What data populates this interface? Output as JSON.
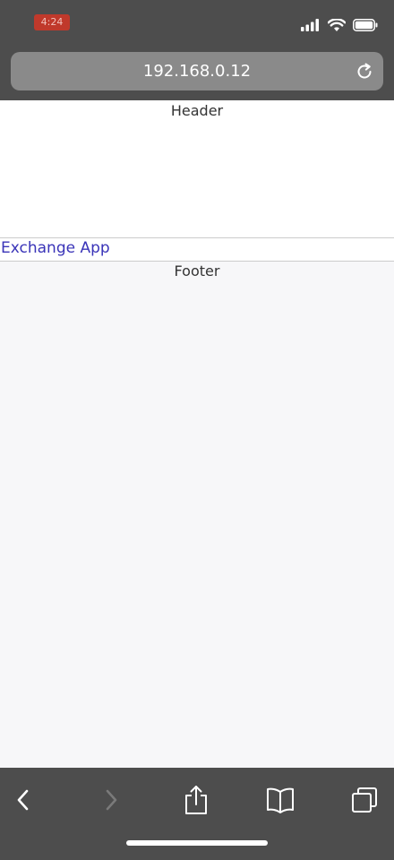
{
  "status_bar": {
    "time": "4:24",
    "icons": [
      "signal-icon",
      "wifi-icon",
      "battery-icon"
    ]
  },
  "address_bar": {
    "url": "192.168.0.12"
  },
  "page": {
    "header": "Header",
    "nav_link": "Exchange App",
    "footer": "Footer"
  },
  "toolbar": {
    "items": [
      "back-icon",
      "forward-icon",
      "share-icon",
      "bookmarks-icon",
      "tabs-icon"
    ]
  },
  "colors": {
    "chrome": "#4d4d4d",
    "link": "#3a34b8"
  }
}
